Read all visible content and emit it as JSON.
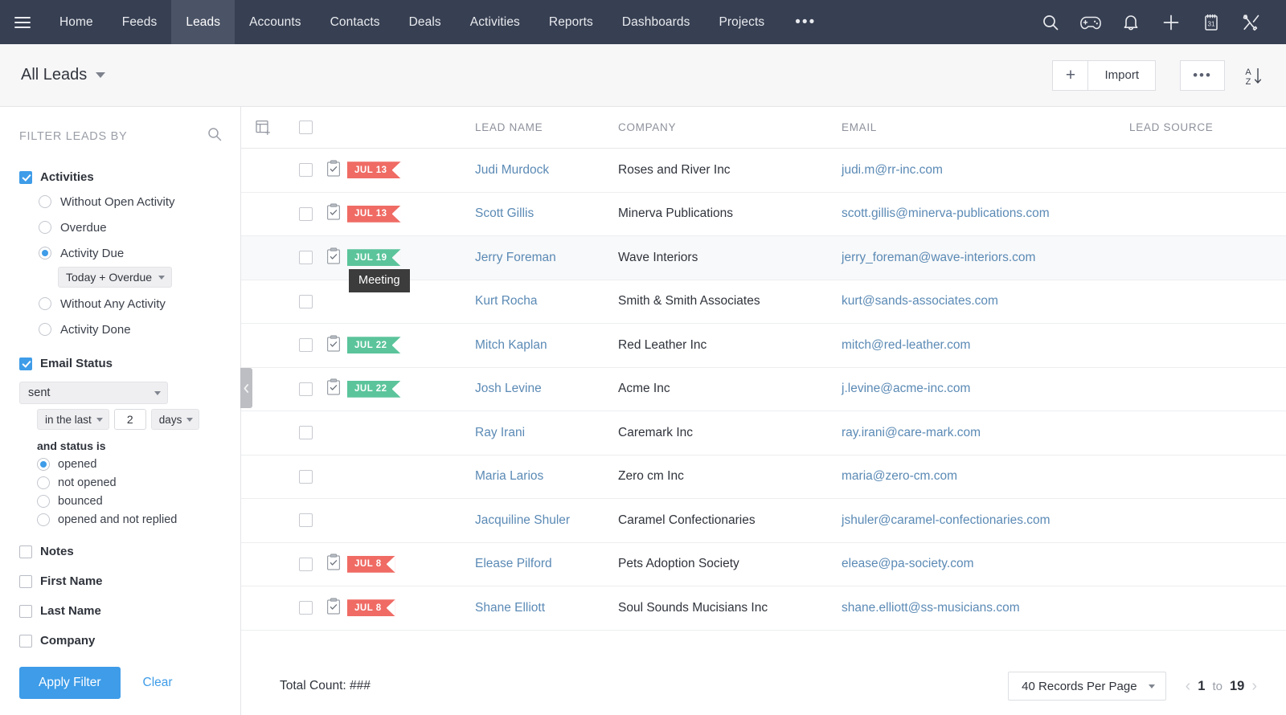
{
  "navbar": {
    "menu_icon": "hamburger-icon",
    "items": [
      {
        "label": "Home",
        "active": false
      },
      {
        "label": "Feeds",
        "active": false
      },
      {
        "label": "Leads",
        "active": true
      },
      {
        "label": "Accounts",
        "active": false
      },
      {
        "label": "Contacts",
        "active": false
      },
      {
        "label": "Deals",
        "active": false
      },
      {
        "label": "Activities",
        "active": false
      },
      {
        "label": "Reports",
        "active": false
      },
      {
        "label": "Dashboards",
        "active": false
      },
      {
        "label": "Projects",
        "active": false
      }
    ],
    "more_label": "•••",
    "right_icons": [
      "search-icon",
      "gamepad-icon",
      "bell-icon",
      "plus-icon",
      "calendar-icon",
      "tools-icon"
    ],
    "calendar_day": "31",
    "background_color": "#373f52",
    "active_tab_color": "#4b5366"
  },
  "toolbar": {
    "view_name": "All Leads",
    "add_label": "+",
    "import_label": "Import",
    "more_label": "•••",
    "sort_letters_top": "A",
    "sort_letters_bottom": "Z"
  },
  "sidebar": {
    "title": "FILTER LEADS BY",
    "search_icon": "search-icon",
    "activities": {
      "label": "Activities",
      "checked": true,
      "options": [
        {
          "label": "Without Open Activity",
          "selected": false
        },
        {
          "label": "Overdue",
          "selected": false
        },
        {
          "label": "Activity Due",
          "selected": true
        },
        {
          "label": "Without Any Activity",
          "selected": false
        },
        {
          "label": "Activity Done",
          "selected": false
        }
      ],
      "due_dropdown_value": "Today + Overdue"
    },
    "email_status": {
      "label": "Email Status",
      "checked": true,
      "main_select_value": "sent",
      "range_select_value": "in the last",
      "range_number": "2",
      "unit_select_value": "days",
      "status_label": "and status is",
      "status_options": [
        {
          "label": "opened",
          "selected": true
        },
        {
          "label": "not opened",
          "selected": false
        },
        {
          "label": "bounced",
          "selected": false
        },
        {
          "label": "opened and not replied",
          "selected": false
        }
      ]
    },
    "other_filters": [
      {
        "label": "Notes",
        "checked": false
      },
      {
        "label": "First Name",
        "checked": false
      },
      {
        "label": "Last Name",
        "checked": false
      },
      {
        "label": "Company",
        "checked": false
      }
    ],
    "apply_label": "Apply Filter",
    "clear_label": "Clear",
    "accent_color": "#3e9ce8"
  },
  "table": {
    "columns": [
      "LEAD NAME",
      "COMPANY",
      "EMAIL",
      "LEAD SOURCE"
    ],
    "settings_icon": "column-settings-icon",
    "rows": [
      {
        "flag": "JUL 13",
        "flag_color": "red",
        "name": "Judi Murdock",
        "company": "Roses and River Inc",
        "email": "judi.m@rr-inc.com",
        "source": "",
        "highlight": false,
        "tooltip": ""
      },
      {
        "flag": "JUL 13",
        "flag_color": "red",
        "name": "Scott Gillis",
        "company": "Minerva Publications",
        "email": "scott.gillis@minerva-publications.com",
        "source": "",
        "highlight": false,
        "tooltip": ""
      },
      {
        "flag": "JUL 19",
        "flag_color": "green",
        "name": "Jerry Foreman",
        "company": "Wave Interiors",
        "email": "jerry_foreman@wave-interiors.com",
        "source": "",
        "highlight": true,
        "tooltip": "Meeting"
      },
      {
        "flag": "",
        "flag_color": "",
        "name": "Kurt Rocha",
        "company": "Smith & Smith Associates",
        "email": "kurt@sands-associates.com",
        "source": "",
        "highlight": false,
        "tooltip": ""
      },
      {
        "flag": "JUL 22",
        "flag_color": "green",
        "name": "Mitch Kaplan",
        "company": "Red Leather Inc",
        "email": "mitch@red-leather.com",
        "source": "",
        "highlight": false,
        "tooltip": ""
      },
      {
        "flag": "JUL 22",
        "flag_color": "green",
        "name": "Josh Levine",
        "company": "Acme Inc",
        "email": "j.levine@acme-inc.com",
        "source": "",
        "highlight": false,
        "tooltip": ""
      },
      {
        "flag": "",
        "flag_color": "",
        "name": "Ray Irani",
        "company": "Caremark Inc",
        "email": "ray.irani@care-mark.com",
        "source": "",
        "highlight": false,
        "tooltip": ""
      },
      {
        "flag": "",
        "flag_color": "",
        "name": "Maria Larios",
        "company": "Zero cm Inc",
        "email": "maria@zero-cm.com",
        "source": "",
        "highlight": false,
        "tooltip": ""
      },
      {
        "flag": "",
        "flag_color": "",
        "name": "Jacquiline Shuler",
        "company": "Caramel Confectionaries",
        "email": "jshuler@caramel-confectionaries.com",
        "source": "",
        "highlight": false,
        "tooltip": ""
      },
      {
        "flag": "JUL 8",
        "flag_color": "red",
        "name": "Elease Pilford",
        "company": "Pets Adoption Society",
        "email": "elease@pa-society.com",
        "source": "",
        "highlight": false,
        "tooltip": ""
      },
      {
        "flag": "JUL 8",
        "flag_color": "red",
        "name": "Shane Elliott",
        "company": "Soul Sounds Mucisians Inc",
        "email": "shane.elliott@ss-musicians.com",
        "source": "",
        "highlight": false,
        "tooltip": ""
      }
    ],
    "flag_red_color": "#ef6b64",
    "flag_green_color": "#5bc49b",
    "link_color": "#5b8ab5"
  },
  "footer": {
    "total_count_label": "Total Count: ###",
    "records_per_page": "40 Records Per Page",
    "page_from": "1",
    "page_to_label": "to",
    "page_to": "19"
  }
}
